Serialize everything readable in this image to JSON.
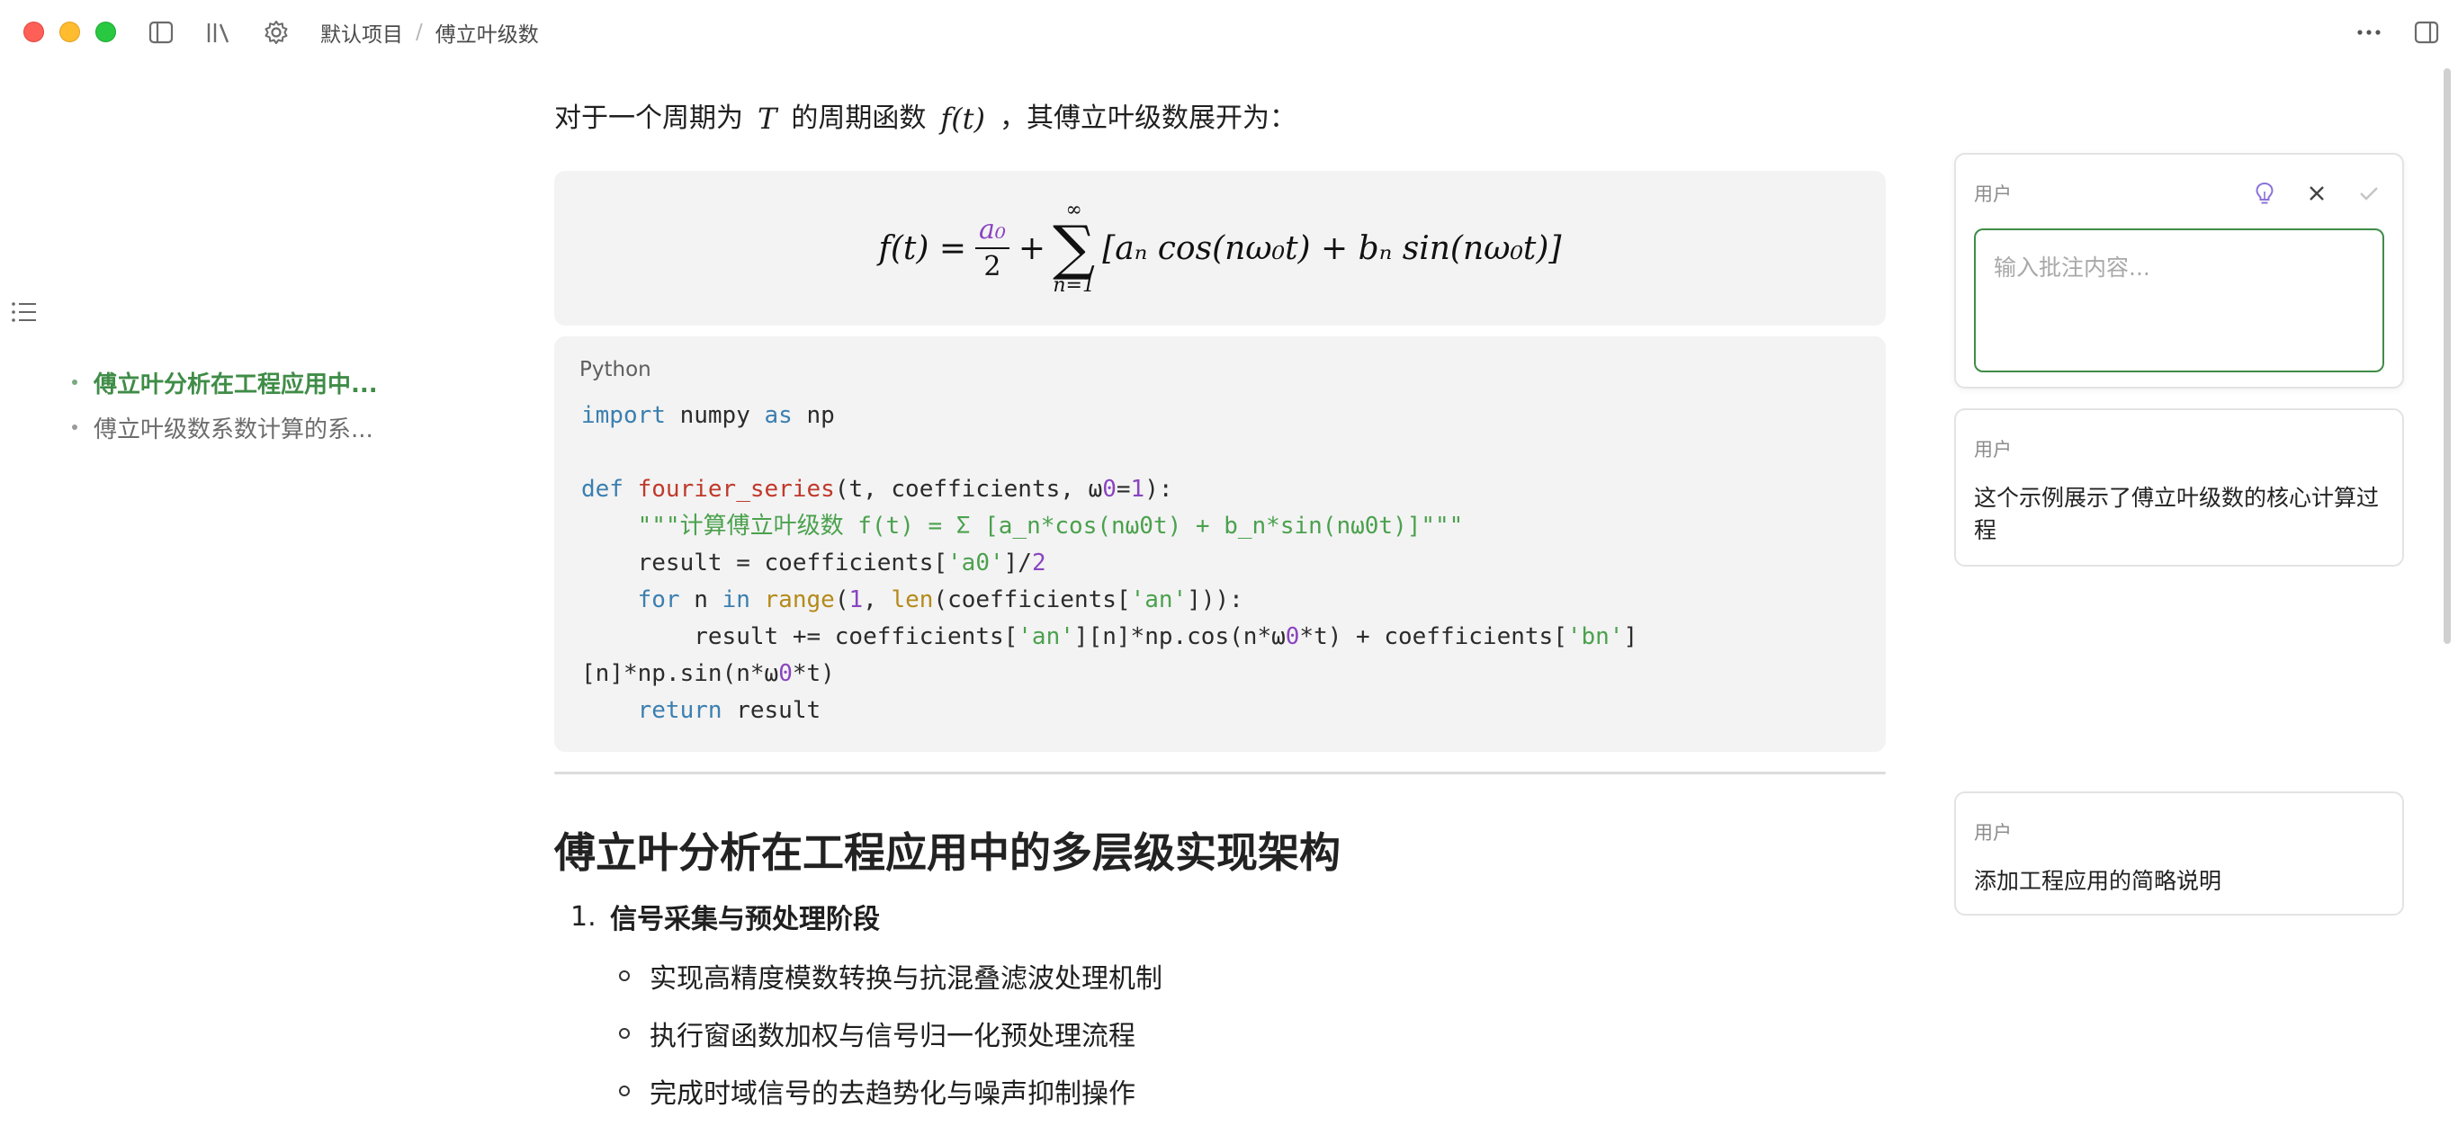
{
  "app": {
    "breadcrumb": {
      "project": "默认项目",
      "separator": "/",
      "document": "傅立叶级数"
    }
  },
  "outline": {
    "items": [
      {
        "label": "傅立叶分析在工程应用中...",
        "active": true
      },
      {
        "label": "傅立叶级数系数计算的系...",
        "active": false
      }
    ]
  },
  "doc": {
    "intro": {
      "prefix": "对于一个周期为",
      "var_T": "T",
      "middle": "的周期函数",
      "var_f": "f(t)",
      "suffix": "，其傅立叶级数展开为："
    },
    "formula": {
      "lhs": "f(t) =",
      "frac_num": "a₀",
      "frac_den": "2",
      "plus": "+",
      "sum_upper": "∞",
      "sum_symbol": "∑",
      "sum_lower": "n=1",
      "body": "[aₙ cos(nω₀t) + bₙ sin(nω₀t)]"
    },
    "code": {
      "language": "Python",
      "lines": [
        "import numpy as np",
        "",
        "def fourier_series(t, coefficients, ω0=1):",
        "    \"\"\"计算傅立叶级数 f(t) = Σ [a_n*cos(nω0t) + b_n*sin(nω0t)]\"\"\"",
        "    result = coefficients['a0']/2",
        "    for n in range(1, len(coefficients['an'])):",
        "        result += coefficients['an'][n]*np.cos(n*ω0*t) + coefficients['bn']",
        "[n]*np.sin(n*ω0*t)",
        "    return result"
      ]
    },
    "heading": "傅立叶分析在工程应用中的多层级实现架构",
    "list": {
      "number": "1.",
      "title": "信号采集与预处理阶段",
      "subitems": [
        "实现高精度模数转换与抗混叠滤波处理机制",
        "执行窗函数加权与信号归一化预处理流程",
        "完成时域信号的去趋势化与噪声抑制操作"
      ]
    }
  },
  "comments": {
    "editor": {
      "user": "用户",
      "placeholder": "输入批注内容...",
      "value": ""
    },
    "items": [
      {
        "user": "用户",
        "text": "这个示例展示了傅立叶级数的核心计算过程"
      },
      {
        "user": "用户",
        "text": "添加工程应用的简略说明"
      }
    ]
  },
  "colors": {
    "accent_green": "#3f8c47",
    "keyword_blue": "#3b7fb0",
    "function_red": "#c0392b",
    "string_green": "#4ba14e",
    "number_purple": "#8a44c0"
  },
  "icons": [
    "sidebar-toggle-icon",
    "library-icon",
    "settings-gear-icon",
    "more-dots-icon",
    "right-panel-icon",
    "outline-list-icon",
    "lightbulb-icon",
    "close-icon",
    "check-icon"
  ]
}
